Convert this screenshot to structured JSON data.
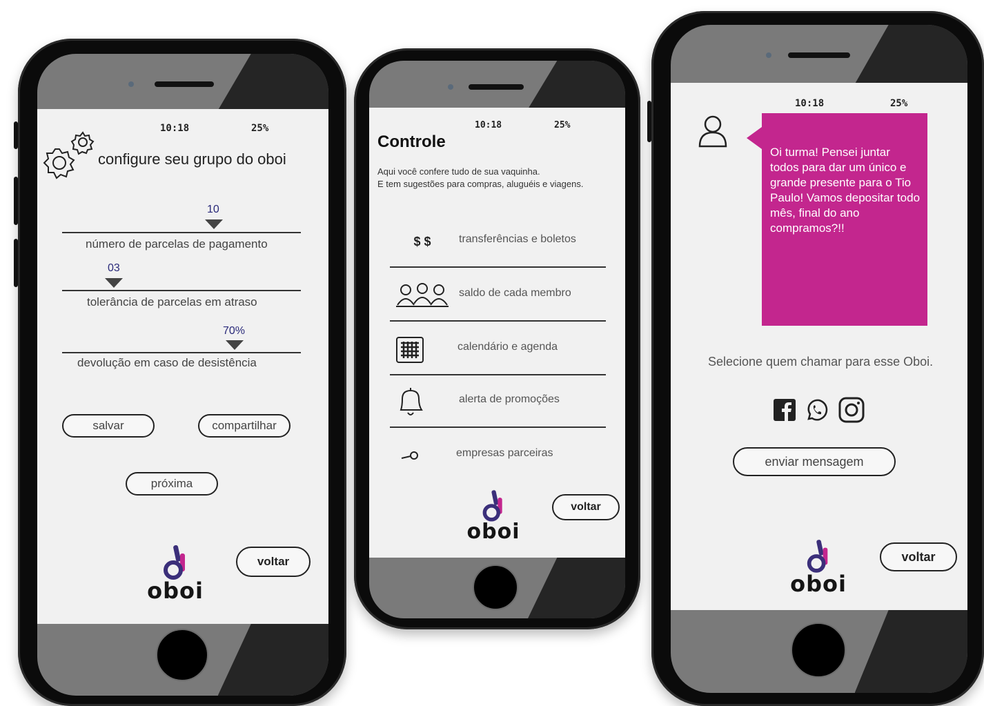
{
  "status": {
    "time": "10:18",
    "battery": "25%",
    "battery_alt": "25%"
  },
  "screen1": {
    "title": "configure seu grupo do oboi",
    "sliders": [
      {
        "value": "10",
        "label": "número de parcelas de pagamento"
      },
      {
        "value": "03",
        "label": "tolerância de parcelas em atraso"
      },
      {
        "value": "70%",
        "label": "devolução em caso de desistência"
      }
    ],
    "buttons": {
      "save": "salvar",
      "share": "compartilhar",
      "next": "próxima",
      "back": "voltar"
    }
  },
  "screen2": {
    "title": "Controle",
    "subtitle_line1": "Aqui você confere tudo de sua vaquinha.",
    "subtitle_line2": "E tem sugestões para compras, aluguéis e viagens.",
    "menu": [
      {
        "icon": "money-icon",
        "icon_text": "$ $",
        "label": "transferências e boletos"
      },
      {
        "icon": "group-icon",
        "label": "saldo de cada membro"
      },
      {
        "icon": "calendar-icon",
        "label": "calendário e agenda"
      },
      {
        "icon": "bell-icon",
        "label": "alerta de promoções"
      },
      {
        "icon": "key-icon",
        "label": "empresas parceiras"
      }
    ],
    "back": "voltar"
  },
  "screen3": {
    "message": "Oi turma! Pensei juntar todos para dar um único e grande presente para o Tio Paulo! Vamos depositar todo mês, final do ano compramos?!!",
    "prompt": "Selecione quem chamar para esse Oboi.",
    "social": [
      "facebook-icon",
      "whatsapp-icon",
      "instagram-icon"
    ],
    "send": "enviar mensagem",
    "back": "voltar"
  },
  "brand": {
    "name": "oboi",
    "color_primary": "#c3268e",
    "color_secondary": "#3b2f7a"
  }
}
